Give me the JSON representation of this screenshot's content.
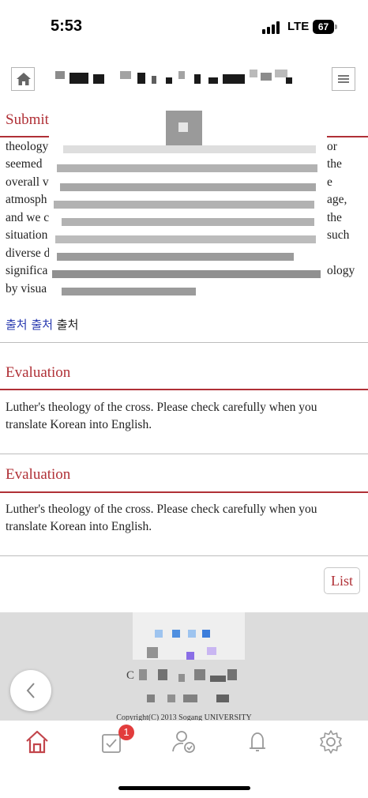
{
  "status_bar": {
    "time": "5:53",
    "network": "LTE",
    "battery": "67"
  },
  "header": {
    "home_icon": "home-icon",
    "menu_icon": "hamburger-menu-icon"
  },
  "submission": {
    "title": "Submit",
    "lines": [
      "theology",
      "seemed",
      "overall v",
      "atmosph",
      "and we c",
      "situation",
      "diverse d",
      "significa",
      "by visua"
    ],
    "right_fragments": [
      "or",
      "the",
      "e",
      "age,",
      "the",
      "such",
      "",
      "ology",
      ""
    ]
  },
  "source_links": [
    "출처",
    "출처",
    "출처"
  ],
  "evaluations": [
    {
      "title": "Evaluation",
      "text": "Luther's theology of the cross. Please check carefully when you translate Korean into English."
    },
    {
      "title": "Evaluation",
      "text": "Luther's theology of the cross. Please check carefully when you translate Korean into English."
    }
  ],
  "list_button": "List",
  "footer": {
    "letter": "C",
    "copyright": "Copyright(C) 2013 Sogang UNIVERSITY"
  },
  "tab_bar": {
    "badge_count": "1",
    "tabs": [
      "home-icon",
      "checklist-icon",
      "user-check-icon",
      "bell-icon",
      "settings-gear-icon"
    ]
  },
  "colors": {
    "accent": "#b03036",
    "link": "#2a3bb0",
    "footer_bg": "#dcdcdc",
    "badge": "#e23c3c"
  }
}
